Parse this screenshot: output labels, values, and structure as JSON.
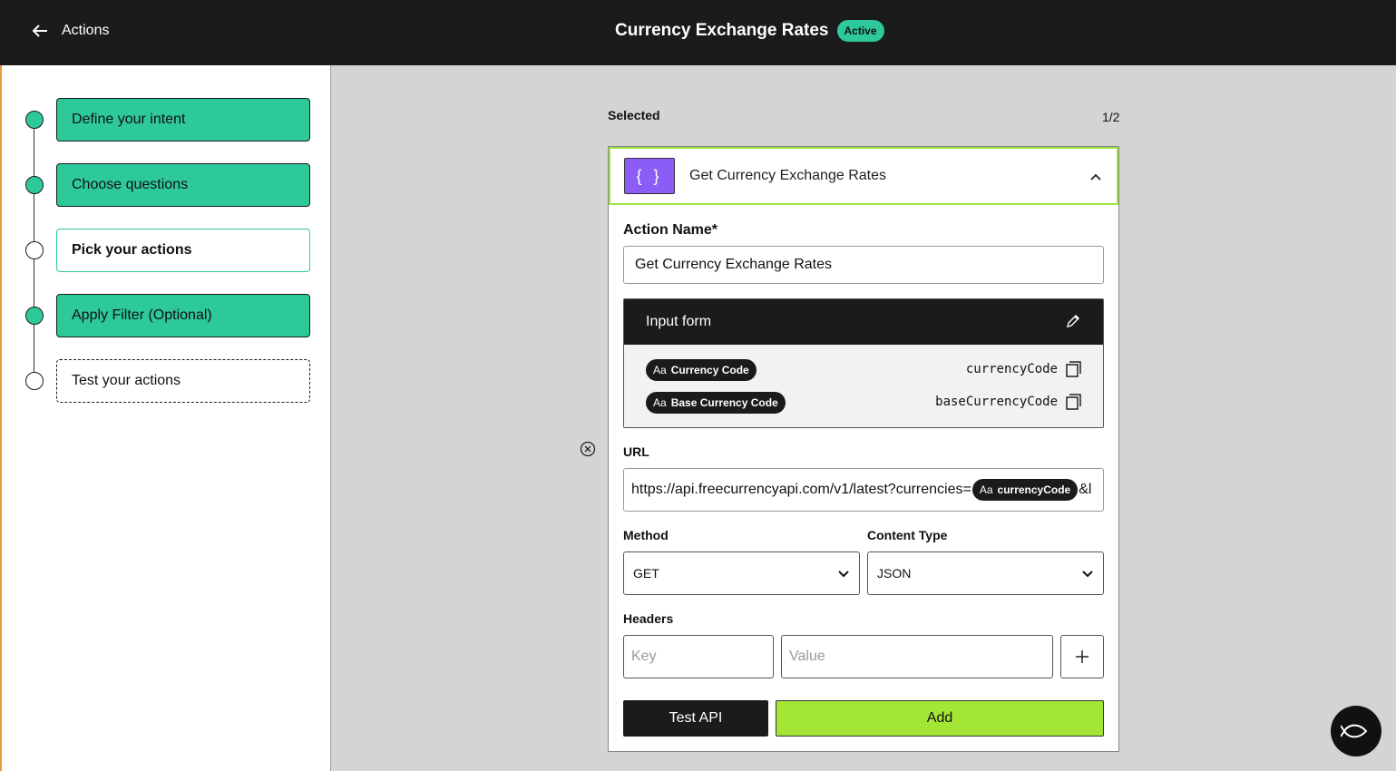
{
  "header": {
    "back_label": "Actions",
    "title": "Currency Exchange Rates",
    "status_badge": "Active"
  },
  "steps": [
    {
      "label": "Define your intent",
      "state": "done"
    },
    {
      "label": "Choose questions",
      "state": "done"
    },
    {
      "label": "Pick your actions",
      "state": "current"
    },
    {
      "label": "Apply Filter (Optional)",
      "state": "done"
    },
    {
      "label": "Test your actions",
      "state": "pending"
    }
  ],
  "main": {
    "selected_label": "Selected",
    "page_count": "1/2",
    "card": {
      "icon_glyph": "{ }",
      "title": "Get Currency Exchange Rates",
      "action_name_label": "Action Name*",
      "action_name_value": "Get Currency Exchange Rates",
      "input_form": {
        "title": "Input form",
        "variables": [
          {
            "chip_prefix": "Aa",
            "label": "Currency Code",
            "key": "currencyCode"
          },
          {
            "chip_prefix": "Aa",
            "label": "Base Currency Code",
            "key": "baseCurrencyCode"
          }
        ]
      },
      "url_label": "URL",
      "url": {
        "prefix": "https://api.freecurrencyapi.com/v1/latest?currencies=",
        "chip_prefix": "Aa",
        "chip_label": "currencyCode",
        "suffix": "&l"
      },
      "method_label": "Method",
      "method_value": "GET",
      "content_type_label": "Content Type",
      "content_type_value": "JSON",
      "headers_label": "Headers",
      "header_key_placeholder": "Key",
      "header_value_placeholder": "Value",
      "test_button": "Test API",
      "add_button": "Add"
    }
  },
  "colors": {
    "accent_green": "#2ec99b",
    "lime": "#a3e635",
    "purple": "#8b5cf6",
    "dark": "#1b1b1b"
  }
}
